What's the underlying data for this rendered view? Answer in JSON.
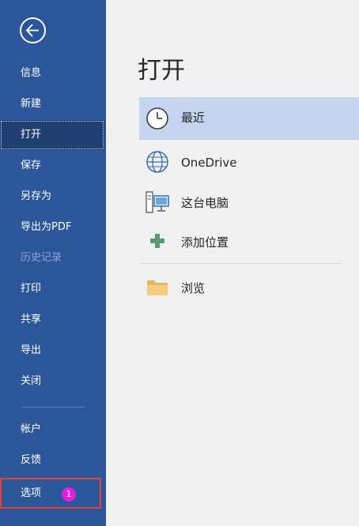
{
  "sidebar": {
    "items": [
      {
        "label": "信息"
      },
      {
        "label": "新建"
      },
      {
        "label": "打开"
      },
      {
        "label": "保存"
      },
      {
        "label": "另存为"
      },
      {
        "label": "导出为PDF"
      },
      {
        "label": "历史记录"
      },
      {
        "label": "打印"
      },
      {
        "label": "共享"
      },
      {
        "label": "导出"
      },
      {
        "label": "关闭"
      },
      {
        "label": "帐户"
      },
      {
        "label": "反馈"
      },
      {
        "label": "选项",
        "badge": "1"
      }
    ]
  },
  "main": {
    "title": "打开",
    "locations": [
      {
        "label": "最近",
        "icon": "clock-icon"
      },
      {
        "label": "OneDrive",
        "icon": "globe-icon"
      },
      {
        "label": "这台电脑",
        "icon": "computer-icon"
      },
      {
        "label": "添加位置",
        "icon": "plus-icon"
      },
      {
        "label": "浏览",
        "icon": "folder-icon"
      }
    ]
  },
  "colors": {
    "sidebar_bg": "#2b579a",
    "selected_bg": "#1f3f73",
    "active_location_bg": "#c5d5ef",
    "highlight_border": "#e0433b",
    "badge_bg": "#e11ee0"
  }
}
